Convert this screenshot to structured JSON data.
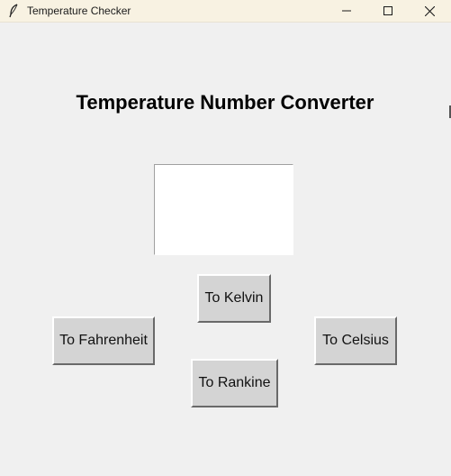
{
  "window": {
    "title": "Temperature Checker",
    "icon": "feather-icon",
    "controls": [
      "minimize-icon",
      "maximize-icon",
      "close-icon"
    ]
  },
  "main": {
    "heading": "Temperature Number Converter",
    "input_value": ""
  },
  "buttons": {
    "kelvin": "To Kelvin",
    "fahrenheit": "To Fahrenheit",
    "celsius": "To Celsius",
    "rankine": "To Rankine"
  },
  "colors": {
    "background": "#f0f0f0",
    "titlebar": "#f8f2e2",
    "button_face": "#d4d4d4"
  }
}
